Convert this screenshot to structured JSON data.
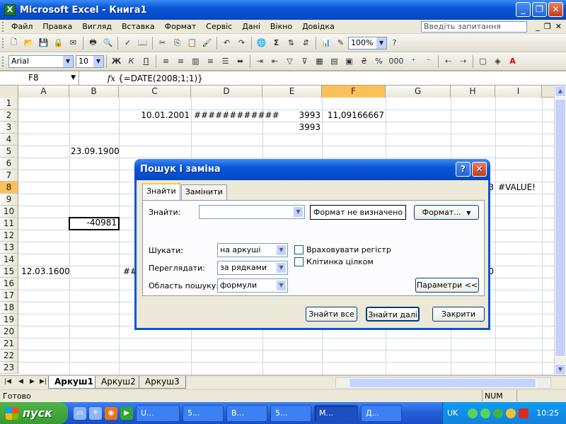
{
  "window": {
    "title": "Microsoft Excel - Книга1"
  },
  "menu": {
    "items": [
      "Файл",
      "Правка",
      "Вигляд",
      "Вставка",
      "Формат",
      "Сервіс",
      "Дані",
      "Вікно",
      "Довідка"
    ],
    "help_placeholder": "Введіть запитання"
  },
  "toolbar": {
    "zoom": "100%",
    "font": "Arial",
    "font_size": "10",
    "sigma": "Σ",
    "percent": "%",
    "thousands": "000"
  },
  "formula_bar": {
    "name_box": "F8",
    "fx": "fx",
    "formula": "{=DATE(2008;1;1)}"
  },
  "grid": {
    "columns": [
      "A",
      "B",
      "C",
      "D",
      "E",
      "F",
      "G",
      "H",
      "I"
    ],
    "active_column": "F",
    "rows": [
      "1",
      "2",
      "3",
      "4",
      "5",
      "6",
      "7",
      "8",
      "9",
      "10",
      "11",
      "12",
      "13",
      "14",
      "15",
      "16",
      "17",
      "18",
      "19",
      "20",
      "21",
      "22",
      "23"
    ],
    "active_row": "8",
    "cells": {
      "C2": "10.01.2001",
      "D2": "############",
      "E2": "3993",
      "F2": "11,09166667",
      "E3": "3993",
      "B5": "23.09.1900",
      "B11": "-40981",
      "A15": "12.03.1600",
      "C15": "##",
      "H8": "3",
      "I8": "#VALUE!",
      "H15": "0"
    }
  },
  "sheets": {
    "tabs": [
      "Аркуш1",
      "Аркуш2",
      "Аркуш3"
    ],
    "active": "Аркуш1"
  },
  "status": {
    "ready": "Готово",
    "num": "NUM"
  },
  "taskbar": {
    "start": "пуск",
    "tasks": [
      "U...",
      "5...",
      "В...",
      "5...",
      "M...",
      "Д..."
    ],
    "lang": "UK",
    "clock": "10:25"
  },
  "dialog": {
    "title": "Пошук і заміна",
    "tabs": [
      "Знайти",
      "Замінити"
    ],
    "find_label": "Знайти:",
    "find_value": "",
    "format_status": "Формат не визначено",
    "format_button": "Формат...",
    "within_label": "Шукати:",
    "within_value": "на аркуші",
    "search_label": "Переглядати:",
    "search_value": "за рядками",
    "lookin_label": "Область пошуку:",
    "lookin_value": "формули",
    "match_case": "Враховувати регістр",
    "match_entire": "Клітинка цілком",
    "options_button": "Параметри <<",
    "find_all": "Знайти все",
    "find_next": "Знайти далі",
    "close": "Закрити"
  }
}
